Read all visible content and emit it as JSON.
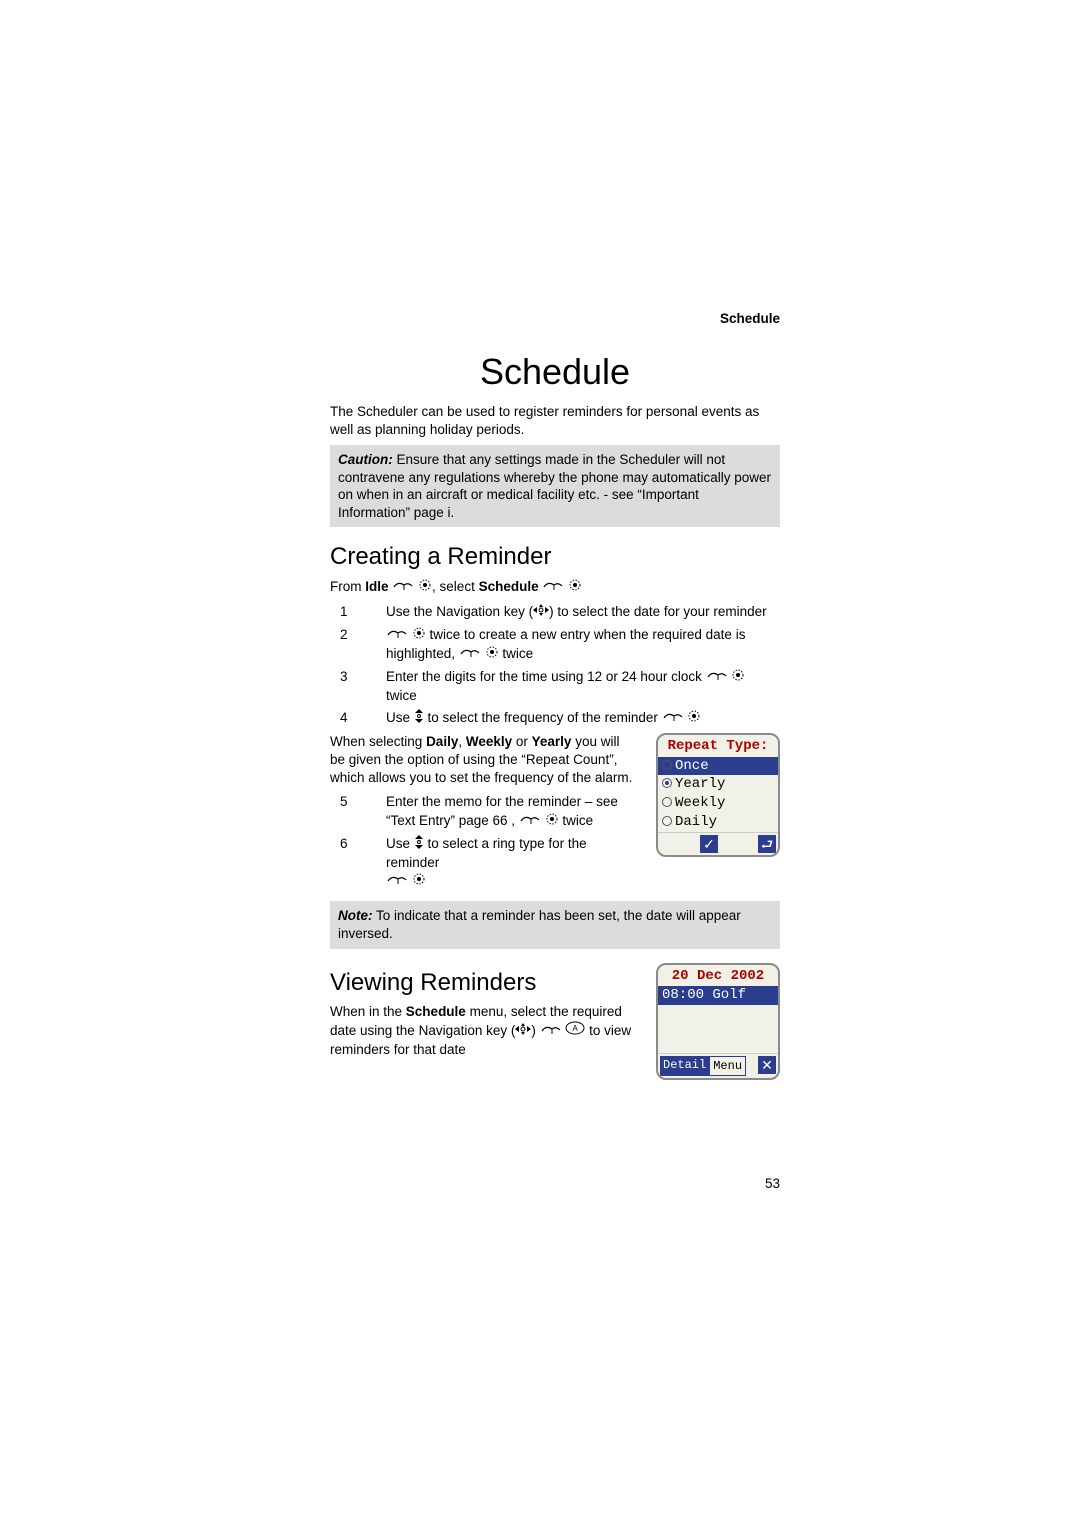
{
  "header": {
    "section_label": "Schedule"
  },
  "title": "Schedule",
  "intro": "The Scheduler can be used to register reminders for personal events as well as planning holiday periods.",
  "caution": {
    "prefix": "Caution:",
    "text": " Ensure that any settings made in the Scheduler will not contravene any regulations whereby the phone may automatically power on when in an aircraft or medical facility etc. - see “Important Information” page i."
  },
  "creating": {
    "heading": "Creating a Reminder",
    "from_line": {
      "prefix": "From ",
      "idle": "Idle",
      "mid": ", select ",
      "schedule": "Schedule"
    },
    "steps": [
      {
        "n": "1",
        "t": "Use the Navigation key (",
        "t2": ") to select the date for your reminder"
      },
      {
        "n": "2",
        "t": "",
        "t2": " twice to create a new entry when the required date is highlighted, ",
        "t3": " twice"
      },
      {
        "n": "3",
        "t": "Enter the digits for the time using 12 or 24 hour clock ",
        "t2": " twice"
      },
      {
        "n": "4",
        "t": "Use ",
        "t2": " to select the frequency of the reminder "
      }
    ],
    "freq_note": {
      "pre": "When selecting ",
      "b1": "Daily",
      "c1": ", ",
      "b2": "Weekly",
      "c2": " or ",
      "b3": "Yearly",
      "rest": " you will be given the option of using the “Repeat Count”, which allows you to set the frequency of the alarm."
    },
    "steps2": [
      {
        "n": "5",
        "t": "Enter the memo for the reminder – see “Text Entry” page 66 , ",
        "t2": " twice"
      },
      {
        "n": "6",
        "t": "Use ",
        "t2": " to select a ring type for the reminder "
      }
    ]
  },
  "note": {
    "prefix": "Note:",
    "text": " To indicate that a reminder has been set, the date will appear inversed."
  },
  "viewing": {
    "heading": "Viewing Reminders",
    "line1_pre": "When in the ",
    "line1_bold": "Schedule",
    "line1_mid": " menu, select the required date using the Navigation key (",
    "line1_post": ")  ",
    "line1_tail": " to view reminders for that date"
  },
  "phone_repeat": {
    "title": "Repeat Type:",
    "opts": [
      "Once",
      "Yearly",
      "Weekly",
      "Daily"
    ],
    "selected_index": 1,
    "soft_ok": "✓",
    "soft_back": "⮐"
  },
  "phone_day": {
    "title": "20 Dec 2002",
    "entry": "08:00 Golf",
    "soft_detail": "Detail",
    "soft_menu": "Menu",
    "soft_close": "✕"
  },
  "page_number": "53"
}
